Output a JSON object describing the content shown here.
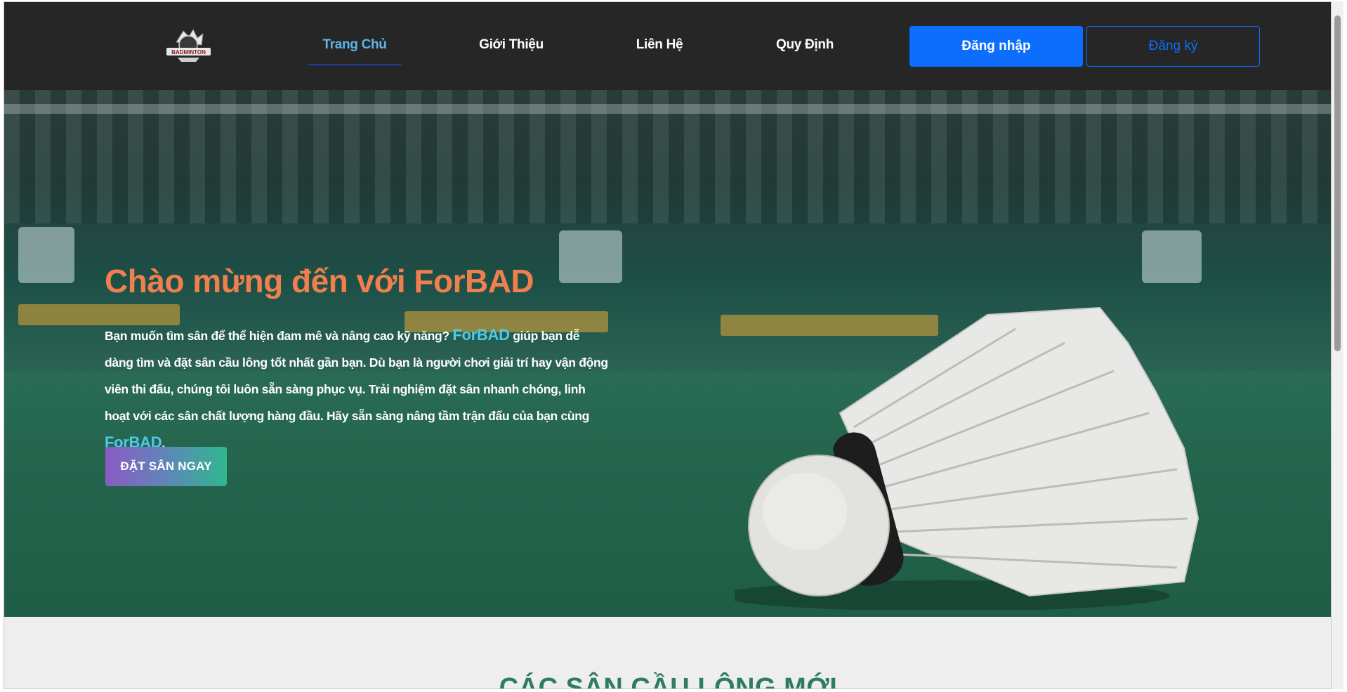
{
  "navbar": {
    "logo_text": "BADMINTON",
    "items": [
      {
        "label": "Trang Chủ",
        "active": true
      },
      {
        "label": "Giới Thiệu",
        "active": false
      },
      {
        "label": "Liên Hệ",
        "active": false
      },
      {
        "label": "Quy Định",
        "active": false
      }
    ],
    "login_label": "Đăng nhập",
    "register_label": "Đăng ký"
  },
  "hero": {
    "title": "Chào mừng đến với ForBAD",
    "text_part1": "Bạn muốn tìm sân để thể hiện đam mê và nâng cao kỹ năng? ",
    "brand": "ForBAD",
    "text_part2": " giúp bạn dễ dàng tìm và đặt sân cầu lông tốt nhất gần bạn. Dù bạn là người chơi giải trí hay vận động viên thi đấu, chúng tôi luôn sẵn sàng phục vụ. Trải nghiệm đặt sân nhanh chóng, linh hoạt với các sân chất lượng hàng đầu. Hãy sẵn sàng nâng tầm trận đấu của bạn cùng ",
    "text_end": ".",
    "cta_label": "ĐẶT SÂN NGAY"
  },
  "section": {
    "title": "CÁC SÂN CẦU LÔNG MỚI"
  },
  "colors": {
    "navbar_bg": "#262626",
    "active_nav": "#5fb3e6",
    "primary": "#0d6efd",
    "hero_title": "#f07f4e",
    "brand": "#4ec9e8",
    "section_title": "#2e7d5f"
  }
}
